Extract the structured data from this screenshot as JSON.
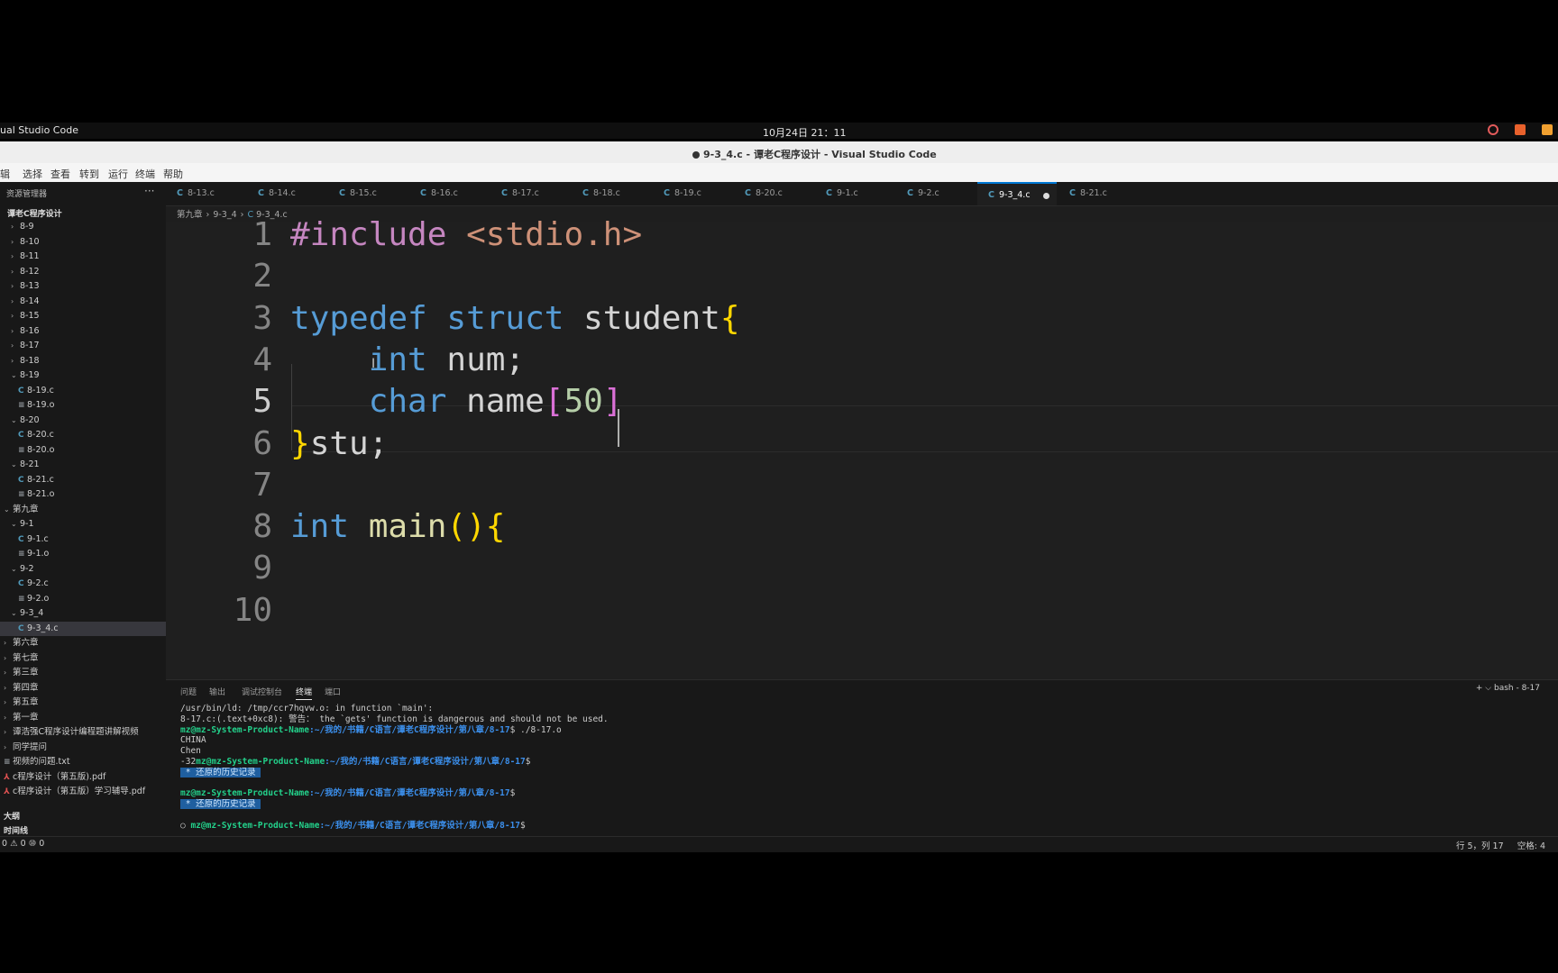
{
  "os_bar": {
    "app_name": "ual Studio Code",
    "clock": "10月24日 21：11"
  },
  "window": {
    "title": "9-3_4.c - 谭老C程序设计 - Visual Studio Code"
  },
  "menu": [
    "辑",
    "选择",
    "查看",
    "转到",
    "运行",
    "终端",
    "帮助"
  ],
  "sidebar": {
    "header": "资源管理器",
    "more": "···",
    "root": "谭老C程序设计",
    "items": [
      {
        "label": "8-9",
        "type": "folder",
        "open": false,
        "depth": 1
      },
      {
        "label": "8-10",
        "type": "folder",
        "open": false,
        "depth": 1
      },
      {
        "label": "8-11",
        "type": "folder",
        "open": false,
        "depth": 1
      },
      {
        "label": "8-12",
        "type": "folder",
        "open": false,
        "depth": 1
      },
      {
        "label": "8-13",
        "type": "folder",
        "open": false,
        "depth": 1
      },
      {
        "label": "8-14",
        "type": "folder",
        "open": false,
        "depth": 1
      },
      {
        "label": "8-15",
        "type": "folder",
        "open": false,
        "depth": 1
      },
      {
        "label": "8-16",
        "type": "folder",
        "open": false,
        "depth": 1
      },
      {
        "label": "8-17",
        "type": "folder",
        "open": false,
        "depth": 1
      },
      {
        "label": "8-18",
        "type": "folder",
        "open": false,
        "depth": 1
      },
      {
        "label": "8-19",
        "type": "folder",
        "open": true,
        "depth": 1
      },
      {
        "label": "8-19.c",
        "type": "c",
        "depth": 2
      },
      {
        "label": "8-19.o",
        "type": "o",
        "depth": 2
      },
      {
        "label": "8-20",
        "type": "folder",
        "open": true,
        "depth": 1
      },
      {
        "label": "8-20.c",
        "type": "c",
        "depth": 2
      },
      {
        "label": "8-20.o",
        "type": "o",
        "depth": 2
      },
      {
        "label": "8-21",
        "type": "folder",
        "open": true,
        "depth": 1
      },
      {
        "label": "8-21.c",
        "type": "c",
        "depth": 2
      },
      {
        "label": "8-21.o",
        "type": "o",
        "depth": 2
      },
      {
        "label": "第九章",
        "type": "folder",
        "open": true,
        "depth": 0
      },
      {
        "label": "9-1",
        "type": "folder",
        "open": true,
        "depth": 1
      },
      {
        "label": "9-1.c",
        "type": "c",
        "depth": 2
      },
      {
        "label": "9-1.o",
        "type": "o",
        "depth": 2
      },
      {
        "label": "9-2",
        "type": "folder",
        "open": true,
        "depth": 1
      },
      {
        "label": "9-2.c",
        "type": "c",
        "depth": 2
      },
      {
        "label": "9-2.o",
        "type": "o",
        "depth": 2
      },
      {
        "label": "9-3_4",
        "type": "folder",
        "open": true,
        "depth": 1
      },
      {
        "label": "9-3_4.c",
        "type": "c",
        "depth": 2,
        "selected": true
      },
      {
        "label": "第六章",
        "type": "folder",
        "open": false,
        "depth": 0
      },
      {
        "label": "第七章",
        "type": "folder",
        "open": false,
        "depth": 0
      },
      {
        "label": "第三章",
        "type": "folder",
        "open": false,
        "depth": 0
      },
      {
        "label": "第四章",
        "type": "folder",
        "open": false,
        "depth": 0
      },
      {
        "label": "第五章",
        "type": "folder",
        "open": false,
        "depth": 0
      },
      {
        "label": "第一章",
        "type": "folder",
        "open": false,
        "depth": 0
      },
      {
        "label": "谭浩强C程序设计编程题讲解视频",
        "type": "folder",
        "open": false,
        "depth": 0
      },
      {
        "label": "同学提问",
        "type": "folder",
        "open": false,
        "depth": 0
      },
      {
        "label": "视频的问题.txt",
        "type": "txt",
        "depth": 0
      },
      {
        "label": "c程序设计（第五版).pdf",
        "type": "pdf",
        "depth": 0
      },
      {
        "label": "c程序设计（第五版）学习辅导.pdf",
        "type": "pdf",
        "depth": 0
      }
    ],
    "outline": "大纲",
    "timeline": "时间线"
  },
  "tabs": [
    {
      "label": "8-13.c"
    },
    {
      "label": "8-14.c"
    },
    {
      "label": "8-15.c"
    },
    {
      "label": "8-16.c"
    },
    {
      "label": "8-17.c"
    },
    {
      "label": "8-18.c"
    },
    {
      "label": "8-19.c"
    },
    {
      "label": "8-20.c"
    },
    {
      "label": "9-1.c"
    },
    {
      "label": "9-2.c"
    },
    {
      "label": "9-3_4.c",
      "active": true,
      "modified": true
    },
    {
      "label": "8-21.c"
    }
  ],
  "breadcrumb": [
    "第九章",
    "9-3_4",
    "9-3_4.c"
  ],
  "editor": {
    "current_line": 5,
    "line_numbers": [
      "1",
      "2",
      "3",
      "4",
      "5",
      "6",
      "7",
      "8",
      "9",
      "10"
    ],
    "lines": [
      [
        {
          "t": "#include ",
          "c": "pp"
        },
        {
          "t": "<stdio.h>",
          "c": "str"
        }
      ],
      [],
      [
        {
          "t": "typedef ",
          "c": "kw"
        },
        {
          "t": "struct ",
          "c": "kw"
        },
        {
          "t": "student",
          "c": "id"
        },
        {
          "t": "{",
          "c": "br"
        }
      ],
      [
        {
          "t": "    ",
          "c": "id"
        },
        {
          "t": "int ",
          "c": "kw"
        },
        {
          "t": "num;",
          "c": "id"
        }
      ],
      [
        {
          "t": "    ",
          "c": "id"
        },
        {
          "t": "char ",
          "c": "kw"
        },
        {
          "t": "name",
          "c": "id"
        },
        {
          "t": "[",
          "c": "br2"
        },
        {
          "t": "50",
          "c": "num"
        },
        {
          "t": "]",
          "c": "br2"
        }
      ],
      [
        {
          "t": "}",
          "c": "br"
        },
        {
          "t": "stu;",
          "c": "id"
        }
      ],
      [],
      [
        {
          "t": "int ",
          "c": "kw"
        },
        {
          "t": "main",
          "c": "fn"
        },
        {
          "t": "(){",
          "c": "br"
        }
      ],
      [],
      []
    ]
  },
  "panel": {
    "tabs": [
      "问题",
      "输出",
      "调试控制台",
      "终端",
      "端口"
    ],
    "active_tab": "终端",
    "actions": "+ ⌵   bash - 8-17",
    "terminal": [
      [
        {
          "t": "/usr/bin/ld: /tmp/ccr7hqvw.o: in function `main':"
        }
      ],
      [
        {
          "t": "8-17.c:(.text+0xc8): 警告： the `gets' function is dangerous and should not be used."
        }
      ],
      [
        {
          "t": "mz@mz-System-Product-Name",
          "c": "prompt-user"
        },
        {
          "t": ":~/我的/书籍/C语言/谭老C程序设计/第八章/8-17",
          "c": "prompt-path"
        },
        {
          "t": "$ ./8-17.o"
        }
      ],
      [
        {
          "t": "CHINA"
        }
      ],
      [
        {
          "t": "Chen"
        }
      ],
      [
        {
          "t": "-32"
        },
        {
          "t": "mz@mz-System-Product-Name",
          "c": "prompt-user"
        },
        {
          "t": ":~/我的/书籍/C语言/谭老C程序设计/第八章/8-17",
          "c": "prompt-path"
        },
        {
          "t": "$"
        }
      ],
      [
        {
          "t": " * 还原的历史记录 ",
          "c": "hl"
        }
      ],
      [
        {
          "t": ""
        }
      ],
      [
        {
          "t": "mz@mz-System-Product-Name",
          "c": "prompt-user"
        },
        {
          "t": ":~/我的/书籍/C语言/谭老C程序设计/第八章/8-17",
          "c": "prompt-path"
        },
        {
          "t": "$"
        }
      ],
      [
        {
          "t": " * 还原的历史记录 ",
          "c": "hl"
        }
      ],
      [
        {
          "t": ""
        }
      ],
      [
        {
          "t": "○ "
        },
        {
          "t": "mz@mz-System-Product-Name",
          "c": "prompt-user"
        },
        {
          "t": ":~/我的/书籍/C语言/谭老C程序设计/第八章/8-17",
          "c": "prompt-path"
        },
        {
          "t": "$"
        }
      ]
    ]
  },
  "statusbar": {
    "left": "0 ⚠ 0   ⑩ 0",
    "position": "行 5，列 17",
    "spaces": "空格: 4"
  },
  "colors": {
    "accent": "#0078d4",
    "editor_bg": "#1f1f1f",
    "sidebar_bg": "#181818"
  }
}
